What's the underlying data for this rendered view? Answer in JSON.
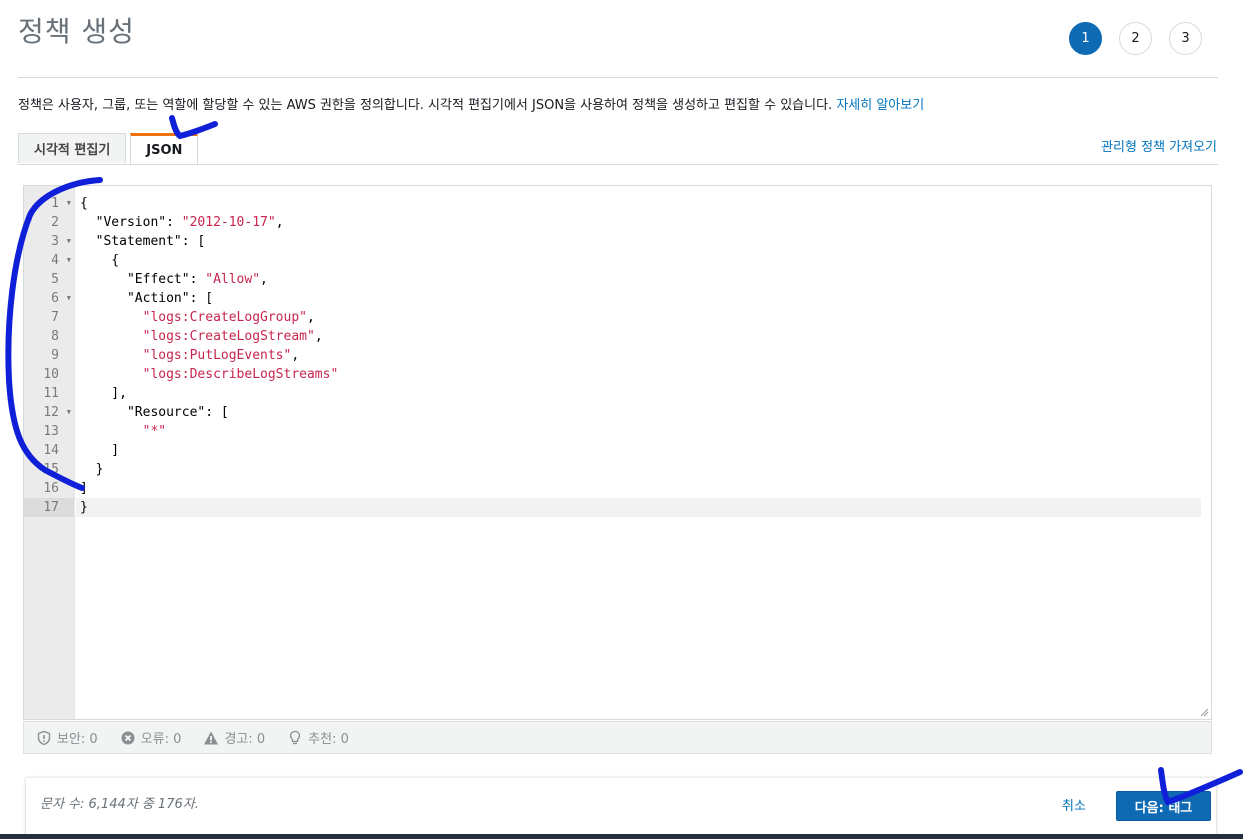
{
  "page": {
    "title": "정책 생성",
    "steps": [
      "1",
      "2",
      "3"
    ],
    "active_step": "1",
    "description": "정책은 사용자, 그룹, 또는 역할에 할당할 수 있는 AWS 권한을 정의합니다. 시각적 편집기에서 JSON을 사용하여 정책을 생성하고 편집할 수 있습니다.",
    "learn_more": "자세히 알아보기"
  },
  "tabs": [
    {
      "label": "시각적 편집기",
      "active": false
    },
    {
      "label": "JSON",
      "active": true
    }
  ],
  "import_link": "관리형 정책 가져오기",
  "editor": {
    "line_numbers": [
      "1",
      "2",
      "3",
      "4",
      "5",
      "6",
      "7",
      "8",
      "9",
      "10",
      "11",
      "12",
      "13",
      "14",
      "15",
      "16",
      "17"
    ],
    "fold_lines": [
      "1",
      "3",
      "4",
      "6",
      "12"
    ],
    "cursor_line": "17",
    "lines": [
      "{",
      "  \"Version\": \"2012-10-17\",",
      "  \"Statement\": [",
      "    {",
      "      \"Effect\": \"Allow\",",
      "      \"Action\": [",
      "        \"logs:CreateLogGroup\",",
      "        \"logs:CreateLogStream\",",
      "        \"logs:PutLogEvents\",",
      "        \"logs:DescribeLogStreams\"",
      "    ],",
      "      \"Resource\": [",
      "        \"*\"",
      "    ]",
      "  }",
      "]",
      "}"
    ]
  },
  "status": {
    "security": "보안: 0",
    "errors": "오류: 0",
    "warnings": "경고: 0",
    "suggestions": "추천: 0"
  },
  "footer": {
    "char_count": "문자 수: 6,144자 중 176자.",
    "cancel": "취소",
    "next": "다음: 태그"
  },
  "colors": {
    "primary": "#0f6ab4",
    "link": "#0073bb",
    "tab_accent": "#ec7211",
    "string": "#c7254e",
    "annotation": "#1020d8"
  }
}
